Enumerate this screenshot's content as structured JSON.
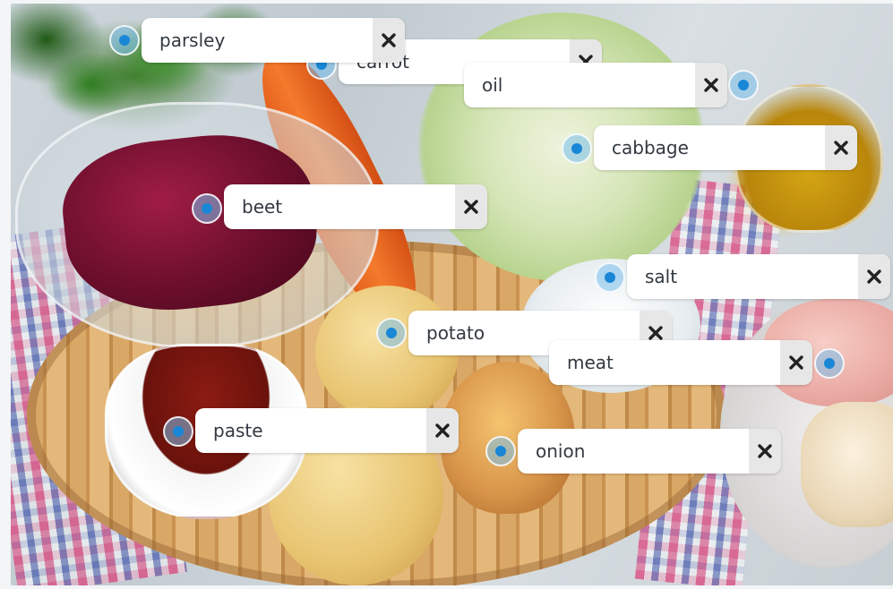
{
  "labels": [
    {
      "id": "carrot",
      "text": "carrot",
      "close_icon": "x-icon"
    },
    {
      "id": "parsley",
      "text": "parsley",
      "close_icon": "x-icon"
    },
    {
      "id": "oil",
      "text": "oil",
      "close_icon": "x-icon"
    },
    {
      "id": "cabbage",
      "text": "cabbage",
      "close_icon": "x-icon"
    },
    {
      "id": "beet",
      "text": "beet",
      "close_icon": "x-icon"
    },
    {
      "id": "salt",
      "text": "salt",
      "close_icon": "x-icon"
    },
    {
      "id": "potato",
      "text": "potato",
      "close_icon": "x-icon"
    },
    {
      "id": "meat",
      "text": "meat",
      "close_icon": "x-icon"
    },
    {
      "id": "paste",
      "text": "paste",
      "close_icon": "x-icon"
    },
    {
      "id": "onion",
      "text": "onion",
      "close_icon": "x-icon"
    }
  ],
  "colors": {
    "label_bg": "#ffffff",
    "close_bg": "#e7e7e7",
    "marker_dot": "#1a86d6",
    "marker_ring": "#78bee9",
    "text": "#333940"
  }
}
